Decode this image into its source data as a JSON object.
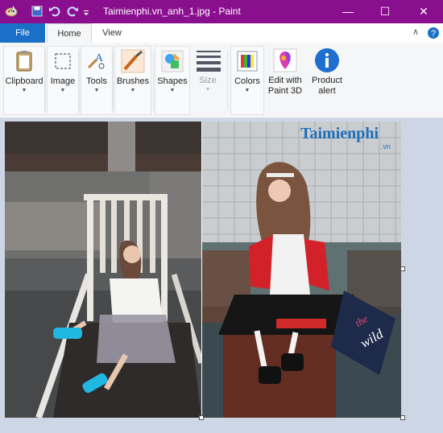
{
  "window": {
    "title": "Taimienphi.vn_anh_1.jpg - Paint",
    "titlebar_color": "#8a0f8f",
    "controls": [
      "minimize",
      "maximize",
      "close"
    ]
  },
  "tabs": {
    "file": "File",
    "home": "Home",
    "view": "View",
    "active": "Home"
  },
  "ribbon": {
    "clipboard": "Clipboard",
    "image": "Image",
    "tools": "Tools",
    "brushes": "Brushes",
    "shapes": "Shapes",
    "size": "Size",
    "colors": "Colors",
    "edit3d_line1": "Edit with",
    "edit3d_line2": "Paint 3D",
    "alert_line1": "Product",
    "alert_line2": "alert"
  },
  "canvas": {
    "watermark_logo": "Taimienphi",
    "watermark_tld": ".vn",
    "sign_text_1": "the",
    "sign_text_2": "wild"
  },
  "colors": {
    "accent": "#1a6fc7",
    "title": "#8a0f8f"
  }
}
